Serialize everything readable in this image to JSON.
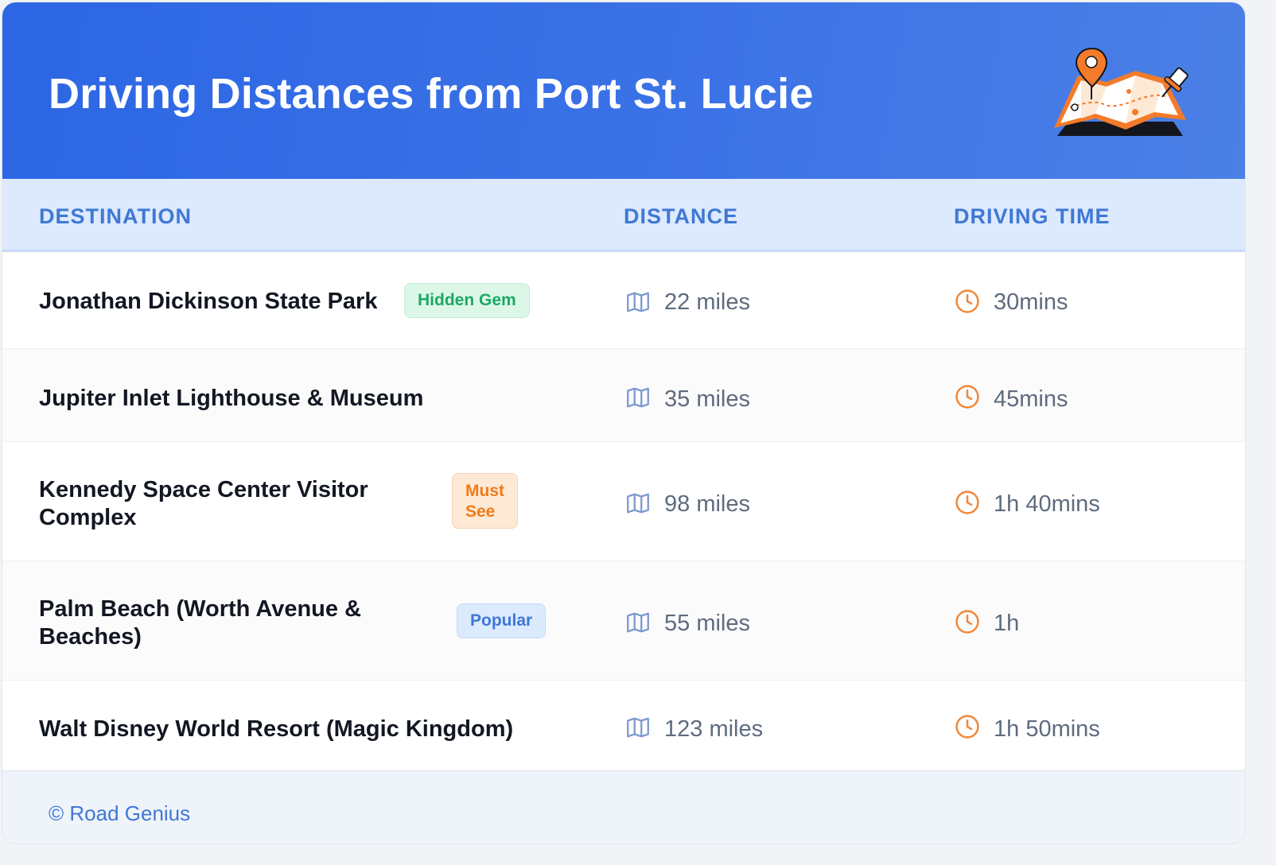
{
  "header": {
    "title": "Driving Distances from Port St. Lucie",
    "illustration_icon": "map-with-pins-icon"
  },
  "table": {
    "columns": [
      "DESTINATION",
      "DISTANCE",
      "DRIVING TIME"
    ],
    "rows": [
      {
        "destination": "Jonathan Dickinson State Park",
        "badge": "Hidden Gem",
        "badge_color": "#1ea864",
        "distance": "22 miles",
        "time": "30mins"
      },
      {
        "destination": "Jupiter Inlet Lighthouse & Museum",
        "badge": "",
        "badge_color": "",
        "distance": "35 miles",
        "time": "45mins"
      },
      {
        "destination_lines": [
          "Kennedy Space Center Visitor",
          "Complex"
        ],
        "badge_lines": [
          "Must",
          "See"
        ],
        "badge_color": "#f07b17",
        "distance": "98 miles",
        "time": "1h 40mins"
      },
      {
        "destination_lines": [
          "Palm Beach (Worth Avenue &",
          "Beaches)"
        ],
        "badge": "Popular",
        "badge_color": "#3f78d6",
        "distance": "55 miles",
        "time": "1h"
      },
      {
        "destination": "Walt Disney World Resort (Magic Kingdom)",
        "badge": "",
        "badge_color": "",
        "distance": "123 miles",
        "time": "1h 50mins"
      }
    ],
    "distance_icon": "map-icon",
    "time_icon": "clock-icon"
  },
  "footer": {
    "credit": "© Road Genius"
  },
  "colors": {
    "header_bg": "#2c66e4",
    "accent": "#3f78d6",
    "clock_icon": "#f08a3c",
    "map_icon": "#7c98cf"
  }
}
